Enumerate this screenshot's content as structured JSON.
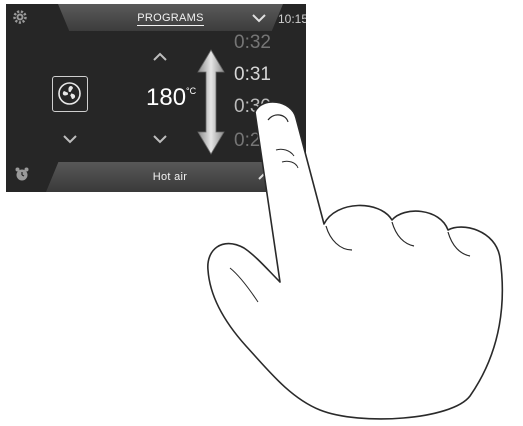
{
  "header": {
    "title": "PROGRAMS",
    "time": "10:15"
  },
  "temperature": {
    "value": "180",
    "unit": "°C"
  },
  "timer": {
    "values": [
      "0:32",
      "0:31",
      "0:30",
      "0:29"
    ]
  },
  "footer": {
    "program": "Hot air"
  },
  "icons": {
    "settings": "gear-icon",
    "fan": "fan-icon",
    "alarm": "alarm-clock-icon",
    "scroll": "double-arrow-icon"
  },
  "colors": {
    "screen": "#262626",
    "text": "#f2f2f2",
    "accent": "#9a9a9a"
  }
}
